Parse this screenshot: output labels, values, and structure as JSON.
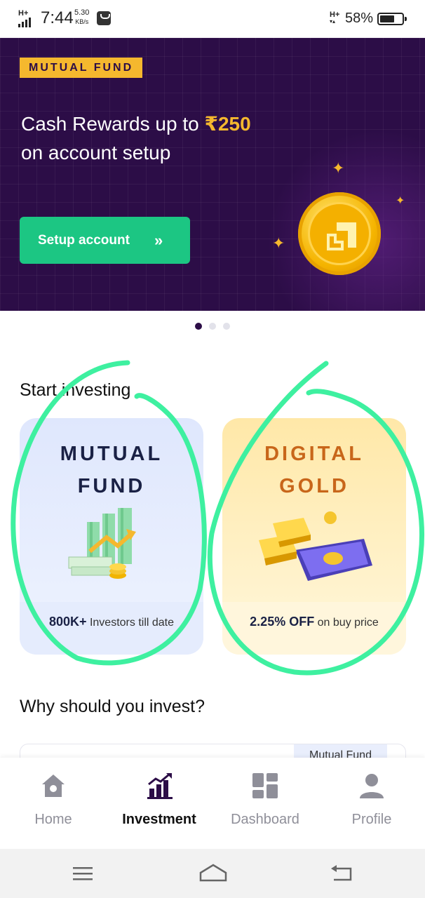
{
  "status_bar": {
    "network_left": "H+",
    "time": "7:44",
    "speed_value": "5.30",
    "speed_unit": "KB/s",
    "network_right": "H+",
    "battery": "58%"
  },
  "banner": {
    "tag": "MUTUAL FUND",
    "headline_prefix": "Cash Rewards up to ",
    "headline_amount": "₹250",
    "headline_line2": "on account setup",
    "cta_label": "Setup account",
    "cta_chevron": "»",
    "colors": {
      "background": "#2c0d47",
      "accent": "#f5b82e",
      "cta": "#1cc683"
    }
  },
  "carousel": {
    "count": 3,
    "active": 0
  },
  "start_investing": {
    "title": "Start investing",
    "cards": [
      {
        "title_line1": "MUTUAL",
        "title_line2": "FUND",
        "stat": "800K+",
        "caption": " Investors till date",
        "icon": "money-stack-chart-icon"
      },
      {
        "title_line1": "DIGITAL",
        "title_line2": "GOLD",
        "stat": "2.25% OFF",
        "caption": " on buy price",
        "icon": "gold-bars-phone-icon"
      }
    ]
  },
  "why": {
    "title": "Why should you invest?",
    "chip": "Mutual Fund"
  },
  "bottom_nav": [
    {
      "label": "Home",
      "icon": "home-icon",
      "active": false
    },
    {
      "label": "Investment",
      "icon": "investment-chart-icon",
      "active": true
    },
    {
      "label": "Dashboard",
      "icon": "dashboard-icon",
      "active": false
    },
    {
      "label": "Profile",
      "icon": "profile-icon",
      "active": false
    }
  ],
  "system_nav": [
    "menu-icon",
    "home-outline-icon",
    "back-icon"
  ],
  "annotation_color": "#3ef0a0"
}
